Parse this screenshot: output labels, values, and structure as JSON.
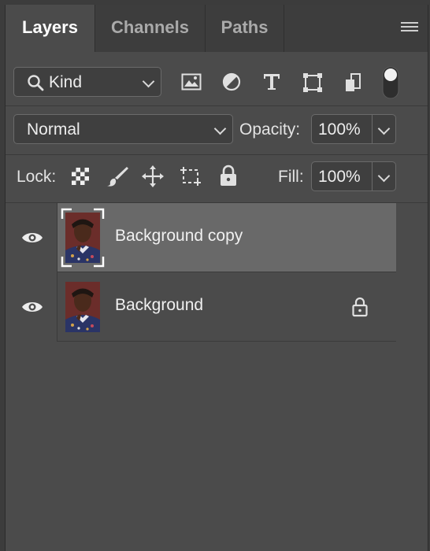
{
  "tabs": [
    {
      "label": "Layers",
      "active": true
    },
    {
      "label": "Channels",
      "active": false
    },
    {
      "label": "Paths",
      "active": false
    }
  ],
  "filter": {
    "kind_label": "Kind",
    "icons": [
      "image-filter-icon",
      "adjustment-filter-icon",
      "type-filter-icon",
      "shape-filter-icon",
      "smart-object-filter-icon",
      "filter-toggle-icon"
    ]
  },
  "blend": {
    "mode": "Normal",
    "opacity_label": "Opacity:",
    "opacity_value": "100%"
  },
  "lock": {
    "label": "Lock:",
    "icons": [
      "lock-transparent-pixels-icon",
      "lock-image-pixels-icon",
      "lock-position-icon",
      "lock-artboard-icon",
      "lock-all-icon"
    ],
    "fill_label": "Fill:",
    "fill_value": "100%"
  },
  "layers": [
    {
      "name": "Background copy",
      "visible": true,
      "selected": true,
      "locked": false
    },
    {
      "name": "Background",
      "visible": true,
      "selected": false,
      "locked": true
    }
  ],
  "colors": {
    "panel_bg": "#4b4b4b",
    "selected_row": "#696969",
    "tab_bar": "#3d3d3d"
  }
}
